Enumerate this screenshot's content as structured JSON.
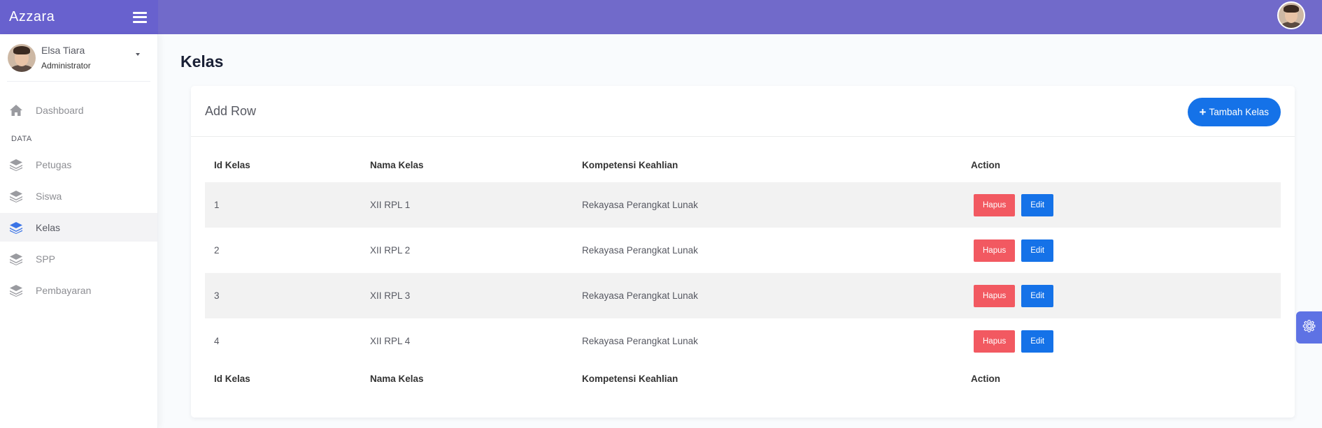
{
  "app": {
    "logo": "Azzara"
  },
  "user": {
    "name": "Elsa Tiara",
    "role": "Administrator"
  },
  "sidebar": {
    "dashboard": "Dashboard",
    "section": "DATA",
    "items": [
      {
        "label": "Petugas",
        "active": false
      },
      {
        "label": "Siswa",
        "active": false
      },
      {
        "label": "Kelas",
        "active": true
      },
      {
        "label": "SPP",
        "active": false
      },
      {
        "label": "Pembayaran",
        "active": false
      }
    ]
  },
  "page": {
    "title": "Kelas"
  },
  "card": {
    "title": "Add Row",
    "add_button": "Tambah Kelas"
  },
  "table": {
    "columns": [
      "Id Kelas",
      "Nama Kelas",
      "Kompetensi Keahlian",
      "Action"
    ],
    "rows": [
      [
        "1",
        "XII RPL 1",
        "Rekayasa Perangkat Lunak"
      ],
      [
        "2",
        "XII RPL 2",
        "Rekayasa Perangkat Lunak"
      ],
      [
        "3",
        "XII RPL 3",
        "Rekayasa Perangkat Lunak"
      ],
      [
        "4",
        "XII RPL 4",
        "Rekayasa Perangkat Lunak"
      ]
    ],
    "delete_label": "Hapus",
    "edit_label": "Edit"
  },
  "colors": {
    "header": "#716aca",
    "logo_bar": "#6861ce",
    "primary": "#1572e8",
    "danger": "#f25961",
    "active_icon": "#3b74e6"
  },
  "icons": {
    "menu": "hamburger-icon",
    "dashboard": "home-icon",
    "nav": "layers-icon",
    "settings": "gear-icon",
    "add": "plus-icon"
  }
}
